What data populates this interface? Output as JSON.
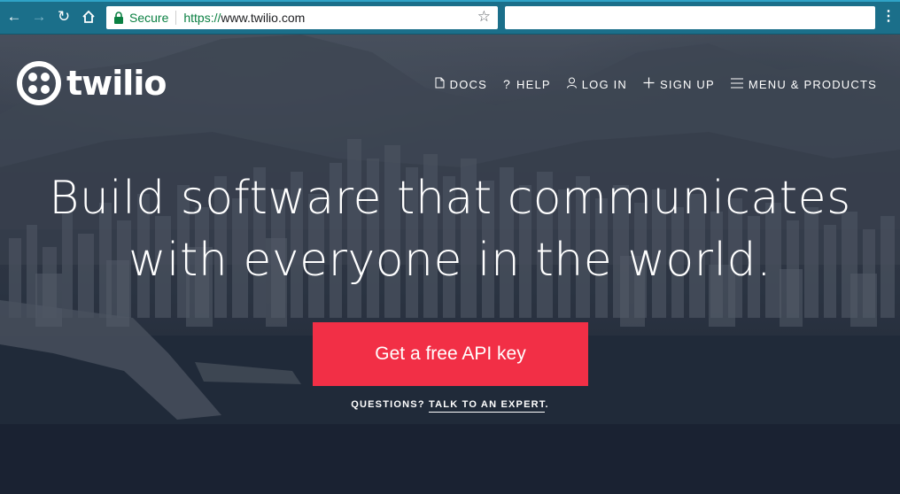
{
  "browser": {
    "secure_label": "Secure",
    "url_scheme": "https://",
    "url_host": "www.twilio.com"
  },
  "header": {
    "logo_text": "twilio",
    "nav": [
      {
        "label": "DOCS",
        "icon": "document-icon"
      },
      {
        "label": "HELP",
        "icon": "question-icon"
      },
      {
        "label": "LOG IN",
        "icon": "user-icon"
      },
      {
        "label": "SIGN UP",
        "icon": "plus-icon"
      },
      {
        "label": "MENU & PRODUCTS",
        "icon": "hamburger-icon"
      }
    ]
  },
  "hero": {
    "headline_line1": "Build software that communicates",
    "headline_line2": "with everyone in the world.",
    "cta_label": "Get a free API key",
    "questions_prefix": "QUESTIONS?",
    "questions_link": "TALK TO AN EXPERT",
    "questions_suffix": "."
  },
  "colors": {
    "chrome": "#1b6f8a",
    "cta": "#f22f46",
    "secure_green": "#0b8043"
  }
}
